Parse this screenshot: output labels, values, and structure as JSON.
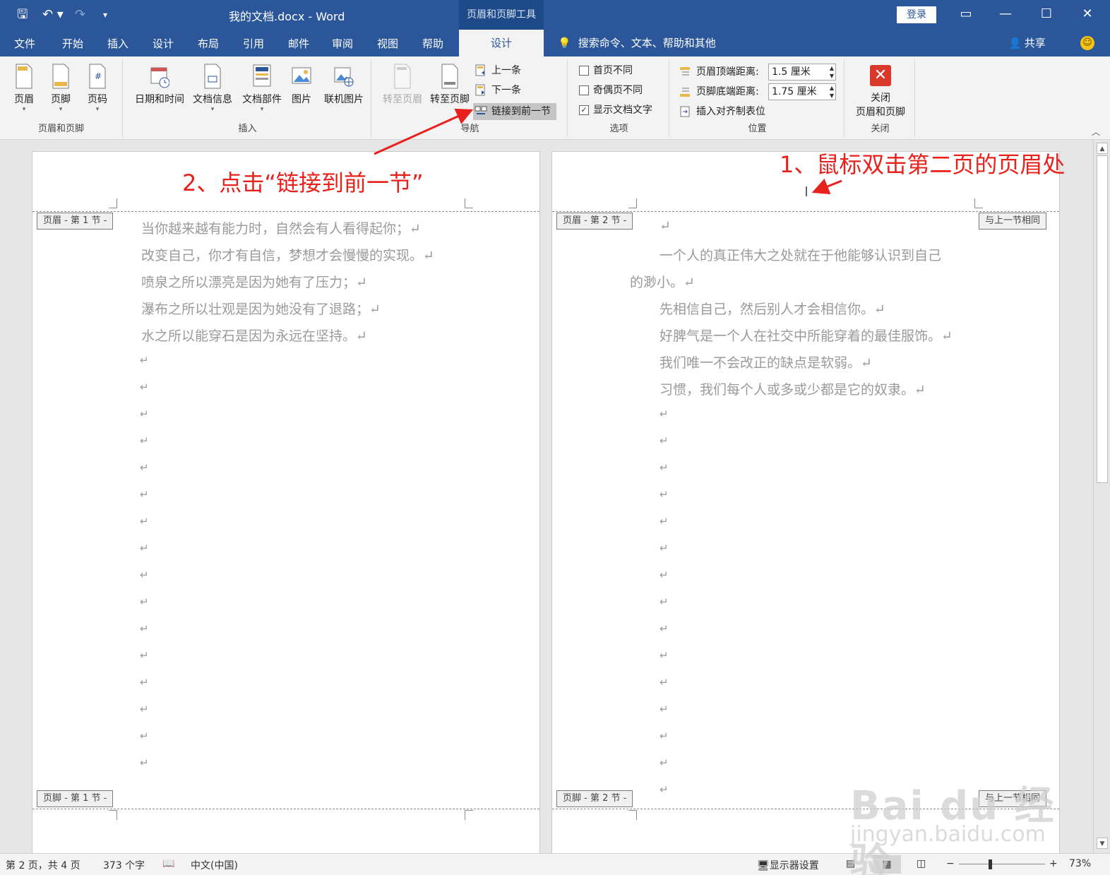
{
  "titlebar": {
    "doc_title": "我的文档.docx  -  Word",
    "tools_tab": "页眉和页脚工具",
    "login": "登录",
    "qa_save": "🖫",
    "qa_undo": "↶ ▾",
    "qa_redo": "↷",
    "qa_customize": "▾",
    "win_display": "▭",
    "win_minimize": "—",
    "win_maximize": "☐",
    "win_close": "✕"
  },
  "menubar": {
    "items": [
      "文件",
      "开始",
      "插入",
      "设计",
      "布局",
      "引用",
      "邮件",
      "审阅",
      "视图",
      "帮助"
    ],
    "active_tab": "设计",
    "tellme": "搜索命令、文本、帮助和其他",
    "share": "共享",
    "smiley": "☺"
  },
  "ribbon": {
    "group_header_footer": {
      "label": "页眉和页脚",
      "header": "页眉",
      "footer": "页脚",
      "page_number": "页码"
    },
    "group_insert": {
      "label": "插入",
      "date_time": "日期和时间",
      "doc_info": "文档信息",
      "doc_parts": "文档部件",
      "picture": "图片",
      "online_picture": "联机图片"
    },
    "group_nav": {
      "label": "导航",
      "goto_header": "转至页眉",
      "goto_footer": "转至页脚",
      "previous": "上一条",
      "next": "下一条",
      "link_previous": "链接到前一节"
    },
    "group_options": {
      "label": "选项",
      "different_first": "首页不同",
      "different_odd_even": "奇偶页不同",
      "show_doc_text": "显示文档文字",
      "check_mark": "✓",
      "show_doc_text_checked": true
    },
    "group_position": {
      "label": "位置",
      "header_top": "页眉顶端距离:",
      "header_top_value": "1.5 厘米",
      "footer_bottom": "页脚底端距离:",
      "footer_bottom_value": "1.75 厘米",
      "insert_tab": "插入对齐制表位"
    },
    "group_close": {
      "label": "关闭",
      "close_line1": "关闭",
      "close_line2": "页眉和页脚",
      "close_glyph": "✕"
    },
    "collapse": "︿"
  },
  "page1": {
    "header_tag": "页眉 - 第 1 节 -",
    "footer_tag": "页脚 - 第 1 节 -",
    "lines": [
      "当你越来越有能力时，自然会有人看得起你；↵",
      "改变自己，你才有自信，梦想才会慢慢的实现。↵",
      "喷泉之所以漂亮是因为她有了压力；↵",
      "瀑布之所以壮观是因为她没有了退路；↵",
      "水之所以能穿石是因为永远在坚持。↵"
    ],
    "para_mark": "↵"
  },
  "page2": {
    "header_tag": "页眉 - 第 2 节 -",
    "same_as_prev": "与上一节相同",
    "footer_tag": "页脚 - 第 2 节 -",
    "footer_same": "与上一节相同",
    "first_line": "↵",
    "lines": [
      "一个人的真正伟大之处就在于他能够认识到自己",
      "的渺小。↵",
      "先相信自己，然后别人才会相信你。↵",
      "好脾气是一个人在社交中所能穿着的最佳服饰。↵",
      "我们唯一不会改正的缺点是软弱。↵",
      "习惯，我们每个人或多或少都是它的奴隶。↵"
    ],
    "para_mark": "↵"
  },
  "annotations": {
    "step1": "1、鼠标双击第二页的页眉处",
    "step2": "2、点击“链接到前一节”",
    "color": "#e8211d"
  },
  "watermark": {
    "brand": "Bai du 经验",
    "url": "jingyan.baidu.com"
  },
  "statusbar": {
    "page": "第 2 页，共 4 页",
    "words": "373 个字",
    "language": "中文(中国)",
    "display_settings": "显示器设置",
    "zoom": "73%",
    "zoom_minus": "−",
    "zoom_plus": "+"
  },
  "scrollbar": {
    "up": "▲",
    "down": "▼"
  },
  "colors": {
    "brand_blue": "#2b579a",
    "ribbon_bg": "#f3f3f3",
    "annotation_red": "#e8211d"
  }
}
